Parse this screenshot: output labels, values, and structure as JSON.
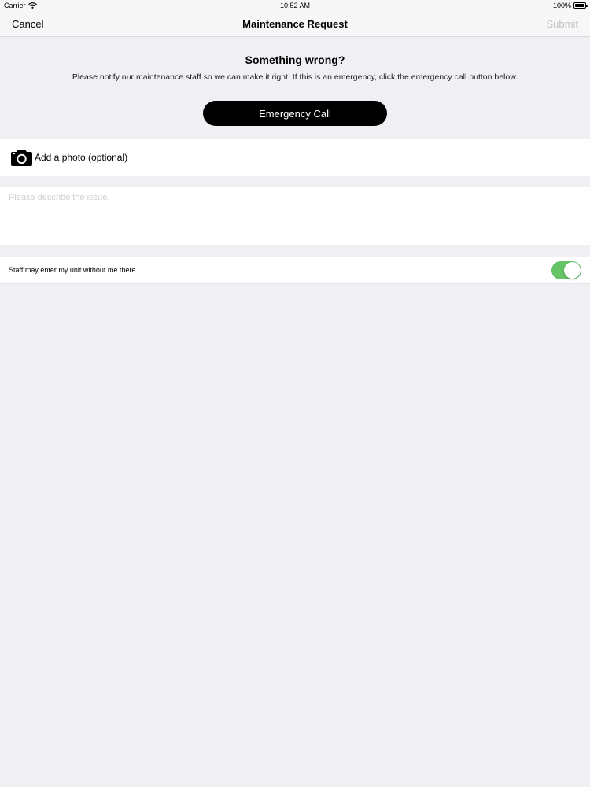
{
  "status_bar": {
    "carrier": "Carrier",
    "time": "10:52 AM",
    "battery": "100%",
    "battery_level": 1.0
  },
  "nav": {
    "cancel_label": "Cancel",
    "title": "Maintenance Request",
    "submit_label": "Submit"
  },
  "header": {
    "title": "Something wrong?",
    "description": "Please notify our maintenance staff so we can make it right. If this is an emergency, click the emergency call button below.",
    "emergency_button": "Emergency Call"
  },
  "photo": {
    "icon": "camera-icon",
    "label": "Add a photo (optional)"
  },
  "description_field": {
    "value": "",
    "placeholder": "Please describe the issue."
  },
  "staff_entry": {
    "label": "Staff may enter my unit without me there.",
    "enabled": true,
    "toggle_color": "#65c466"
  },
  "colors": {
    "background": "#efeff4",
    "submit_disabled": "#c4c4c8"
  }
}
